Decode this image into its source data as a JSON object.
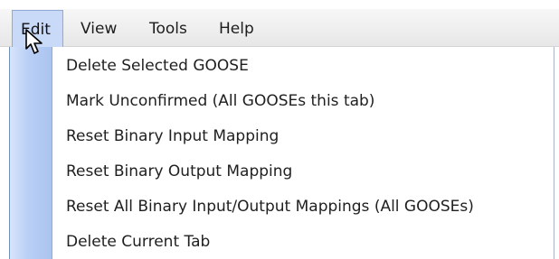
{
  "menubar": {
    "items": [
      {
        "label": "Edit"
      },
      {
        "label": "View"
      },
      {
        "label": "Tools"
      },
      {
        "label": "Help"
      }
    ]
  },
  "dropdown": {
    "items": [
      {
        "label": "Delete Selected GOOSE"
      },
      {
        "label": "Mark Unconfirmed (All GOOSEs this tab)"
      },
      {
        "label": "Reset Binary Input Mapping"
      },
      {
        "label": "Reset Binary Output Mapping"
      },
      {
        "label": "Reset All Binary Input/Output Mappings (All GOOSEs)"
      },
      {
        "label": "Delete Current Tab"
      }
    ]
  },
  "icons": {
    "cursor": "mouse-pointer-icon"
  },
  "colors": {
    "menu_highlight": "#c9daf8",
    "gutter": "#b9cff5",
    "border": "#6f8fb9"
  }
}
